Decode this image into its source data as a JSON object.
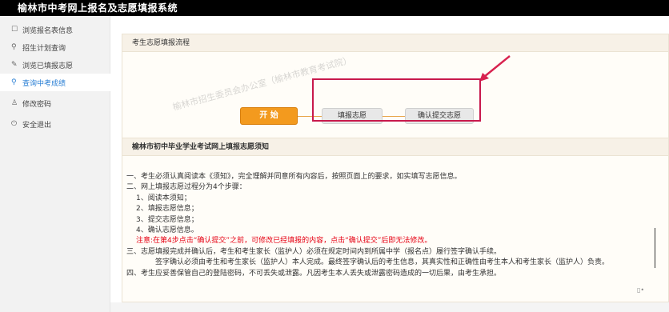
{
  "header": {
    "title": "榆林市中考网上报名及志愿填报系统"
  },
  "sidebar": {
    "items": [
      {
        "icon": "document-icon",
        "glyph": "☐",
        "label": "浏览报名表信息"
      },
      {
        "icon": "search-icon",
        "glyph": "⚲",
        "label": "招生计划查询"
      },
      {
        "icon": "pencil-icon",
        "glyph": "✎",
        "label": "浏览已填报志愿"
      },
      {
        "icon": "search-icon",
        "glyph": "⚲",
        "label": "查询中考成绩",
        "active": true
      },
      {
        "icon": "user-icon",
        "glyph": "♙",
        "label": "修改密码"
      },
      {
        "icon": "power-icon",
        "glyph": "⏻",
        "label": "安全退出"
      }
    ]
  },
  "flow_panel": {
    "title": "考生志愿填报流程",
    "watermark": "榆林市招生委员会办公室（榆林市教育考试院）",
    "start_label": "开 始",
    "steps": [
      "填报志愿",
      "确认提交志愿"
    ]
  },
  "notice_panel": {
    "title": "榆林市初中毕业学业考试网上填报志愿须知",
    "lines": [
      "一、考生必须认真阅读本《须知》，完全理解并同意所有内容后，按照页面上的要求，如实填写志愿信息。",
      "二、网上填报志愿过程分为4个步骤：",
      "1、阅读本须知；",
      "2、填报志愿信息；",
      "3、提交志愿信息；",
      "4、确认志愿信息。",
      "注意:在第4步点击“确认提交”之前，可修改已经填报的内容，点击“确认提交”后即无法修改。",
      "三、志愿填报完成并确认后，考生和考生家长（监护人）必须在规定时间内到所属中学（报名点）履行签字确认手续。",
      "签字确认必须由考生和考生家长（监护人）本人完成。最终签字确认后的考生信息，其真实性和正确性由考生本人和考生家长（监护人）负责。",
      "四、考生应妥善保管自己的登陆密码，不可丢失或泄露。凡因考生本人丢失或泄露密码造成的一切后果，由考生承担。"
    ]
  },
  "colors": {
    "accent": "#2a7fd4",
    "start_button": "#f39a1e",
    "highlight_box": "#c8194c",
    "warning_text": "#e60012"
  }
}
